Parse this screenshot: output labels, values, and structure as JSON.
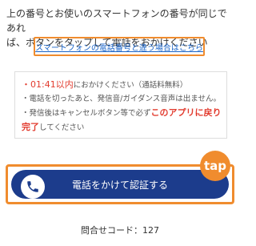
{
  "intro": {
    "line1": "上の番号とお使いのスマートフォンの番号が同じであれ",
    "line2": "ば、ボタンをタップして電話をおかけください"
  },
  "link": {
    "label": "スマートフォンの電話番号と違う場合はこちら",
    "color": "#1a64c8"
  },
  "notice": {
    "bullet1_time": "・01:41以内",
    "bullet1_rest": "におかけください（通話料無料）",
    "bullet2": "・電話を切ったあと、発信音/ガイダンス音声は出ません。",
    "bullet3_pre": "・発信後はキャンセルボタン等で必ず",
    "bullet3_red": "このアプリに戻り",
    "bullet4_red": "完了",
    "bullet4_rest": "してください"
  },
  "call_button": {
    "label": "電話をかけて認証する",
    "icon": "phone-icon",
    "color": "#1c3c8c"
  },
  "tap_label": "tap",
  "inquiry": "問合せコード：127",
  "colors": {
    "accent": "#f08c2e",
    "alert": "#e23b2e"
  }
}
